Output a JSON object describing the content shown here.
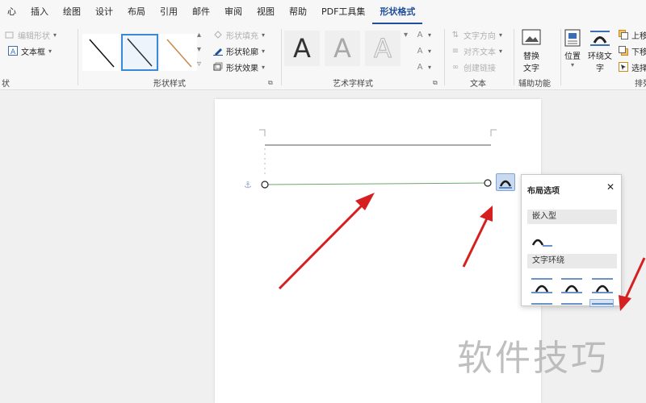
{
  "menubar": {
    "items": [
      {
        "label": "心"
      },
      {
        "label": "插入"
      },
      {
        "label": "绘图"
      },
      {
        "label": "设计"
      },
      {
        "label": "布局"
      },
      {
        "label": "引用"
      },
      {
        "label": "邮件"
      },
      {
        "label": "审阅"
      },
      {
        "label": "视图"
      },
      {
        "label": "帮助"
      },
      {
        "label": "PDF工具集"
      },
      {
        "label": "形状格式"
      }
    ],
    "active": "形状格式"
  },
  "ribbon": {
    "insert_shapes": {
      "edit_shape": "编辑形状",
      "text_box": "文本框",
      "group_label": "状"
    },
    "shape_styles": {
      "group_label": "形状样式",
      "fill": "形状填充",
      "outline": "形状轮廓",
      "effects": "形状效果"
    },
    "wordart": {
      "group_label": "艺术字样式",
      "letter": "A"
    },
    "text": {
      "group_label": "文本",
      "direction": "文字方向",
      "align": "对齐文本",
      "link": "创建链接"
    },
    "accessibility": {
      "group_label": "辅助功能",
      "alt_text_line1": "替换",
      "alt_text_line2": "文字"
    },
    "arrange": {
      "position": "位置",
      "wrap_line1": "环绕文",
      "wrap_line2": "字",
      "bring_forward": "上移",
      "send_backward": "下移",
      "select": "选择",
      "group_label": "排列"
    }
  },
  "layout_popup": {
    "title": "布局选项",
    "inline_section": "嵌入型",
    "wrap_section": "文字环绕"
  },
  "watermark": "软件技巧",
  "colors": {
    "accent": "#1f4e9a",
    "selection": "#3b88d6",
    "arrow": "#d62020",
    "line_green": "#6aa86a"
  }
}
